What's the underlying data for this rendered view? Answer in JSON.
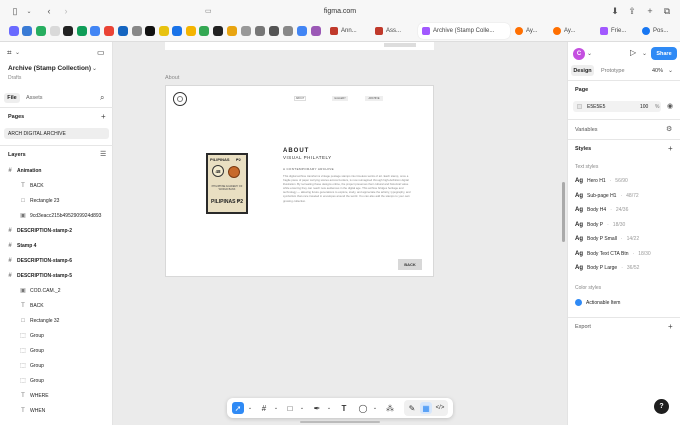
{
  "browser": {
    "url": "figma.com",
    "tabs": [
      {
        "label": "Ann..."
      },
      {
        "label": "Ass..."
      },
      {
        "label": "Archive (Stamp Colle..."
      },
      {
        "label": "Ay..."
      },
      {
        "label": "Ay..."
      },
      {
        "label": "Frie..."
      },
      {
        "label": "Pos..."
      }
    ]
  },
  "file": {
    "title": "Archive (Stamp Collection)",
    "subtitle": "Drafts",
    "tab_file": "File",
    "tab_assets": "Assets"
  },
  "pages": {
    "heading": "Pages",
    "items": [
      "ARCH DIGITAL ARCHIVE"
    ]
  },
  "layers": {
    "heading": "Layers",
    "items": [
      {
        "label": "Animation",
        "level": 0,
        "bold": true,
        "icon": "frame"
      },
      {
        "label": "BACK",
        "level": 1,
        "icon": "text"
      },
      {
        "label": "Rectangle 23",
        "level": 1,
        "icon": "rect"
      },
      {
        "label": "9cd3eacc215b4952909924d893",
        "level": 1,
        "icon": "image"
      },
      {
        "label": "DESCRIPTION-stamp-2",
        "level": 0,
        "bold": true,
        "icon": "frame"
      },
      {
        "label": "Stamp 4",
        "level": 0,
        "bold": true,
        "icon": "frame"
      },
      {
        "label": "DESCRIPTION-stamp-6",
        "level": 0,
        "bold": true,
        "icon": "frame"
      },
      {
        "label": "DESCRIPTION-stamp-5",
        "level": 0,
        "bold": true,
        "icon": "frame"
      },
      {
        "label": "COD.CAM._2",
        "level": 1,
        "icon": "image"
      },
      {
        "label": "BACK",
        "level": 1,
        "icon": "text"
      },
      {
        "label": "Rectangle 32",
        "level": 1,
        "icon": "rect"
      },
      {
        "label": "Group",
        "level": 1,
        "icon": "group"
      },
      {
        "label": "Group",
        "level": 1,
        "icon": "group"
      },
      {
        "label": "Group",
        "level": 1,
        "icon": "group"
      },
      {
        "label": "Group",
        "level": 1,
        "icon": "group"
      },
      {
        "label": "WHERE",
        "level": 1,
        "icon": "text"
      },
      {
        "label": "WHEN",
        "level": 1,
        "icon": "text"
      }
    ]
  },
  "canvas": {
    "frame_label": "About",
    "nav": [
      "ABOUT",
      "GALLERY",
      "ARCHIVE"
    ],
    "heading": "ABOUT",
    "subheading": "VISUAL PHILATELY",
    "kicker": "A CONTEMPORARY ARCHIVE",
    "body": "This digital archive transforms vintage postage stamps into timeless works of art. Each stamp, once a fragile piece of paper carrying stories across borders, is now reimagined through high-definition digital illustration. By recreating these designs online, the project preserves their cultural and historical value while ensuring they can reach new audiences in the digital age. This archive bridges heritage and technology — allowing future generations to explore, study, and appreciate the artistry, typography, and symbolism that once traveled in envelopes around the world. You can also add the stamps to your own growing collection.",
    "stamp_top": "PILIPINAS",
    "stamp_value_top": "₱2",
    "stamp_badge": "48",
    "stamp_caption": "PHILIPPINE ACADEMY OF WORLD BANK",
    "stamp_bottom": "PILIPINAS ₱2",
    "back_button": "BACK"
  },
  "right": {
    "tab_design": "Design",
    "tab_prototype": "Prototype",
    "zoom": "40%",
    "share": "Share",
    "avatar_letter": "C",
    "page_heading": "Page",
    "page_color": "E5E5E5",
    "page_opacity": "100",
    "page_pct": "%",
    "variables": "Variables",
    "styles": "Styles",
    "text_styles_heading": "Text styles",
    "text_styles": [
      {
        "name": "Hero H1",
        "size": "56/90"
      },
      {
        "name": "Sub-page H1",
        "size": "48/72"
      },
      {
        "name": "Body H4",
        "size": "24/36"
      },
      {
        "name": "Body P",
        "size": "18/30"
      },
      {
        "name": "Body P Small",
        "size": "14/22"
      },
      {
        "name": "Body Text CTA Btn",
        "size": "18/30"
      },
      {
        "name": "Body P Large",
        "size": "36/52"
      }
    ],
    "color_styles_heading": "Color styles",
    "color_styles": [
      {
        "name": "Actionable Item",
        "color": "#2f8af5"
      }
    ],
    "export": "Export",
    "help": "?"
  },
  "colors": {
    "accent": "#2f8af5",
    "canvas": "#ebebeb",
    "page_swatch": "#e5e5e5"
  }
}
